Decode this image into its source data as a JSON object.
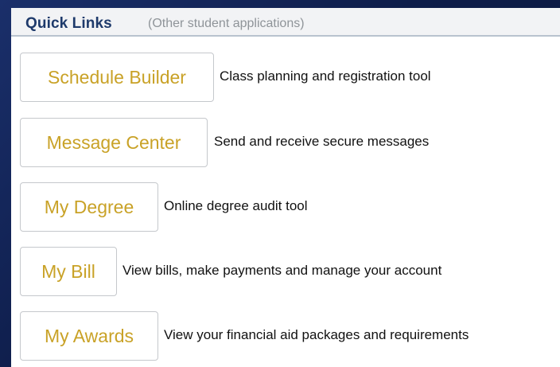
{
  "header": {
    "title": "Quick Links",
    "subtitle": "(Other student applications)"
  },
  "links": [
    {
      "label": "Schedule Builder",
      "description": "Class planning and registration tool"
    },
    {
      "label": "Message Center",
      "description": "Send and receive secure messages"
    },
    {
      "label": "My Degree",
      "description": "Online degree audit tool"
    },
    {
      "label": "My Bill",
      "description": "View bills, make payments and manage your account"
    },
    {
      "label": "My Awards",
      "description": "View your financial aid packages and requirements"
    }
  ],
  "colors": {
    "title": "#1e3a6b",
    "link_text": "#c9a227",
    "background": "#0d1f4c"
  }
}
